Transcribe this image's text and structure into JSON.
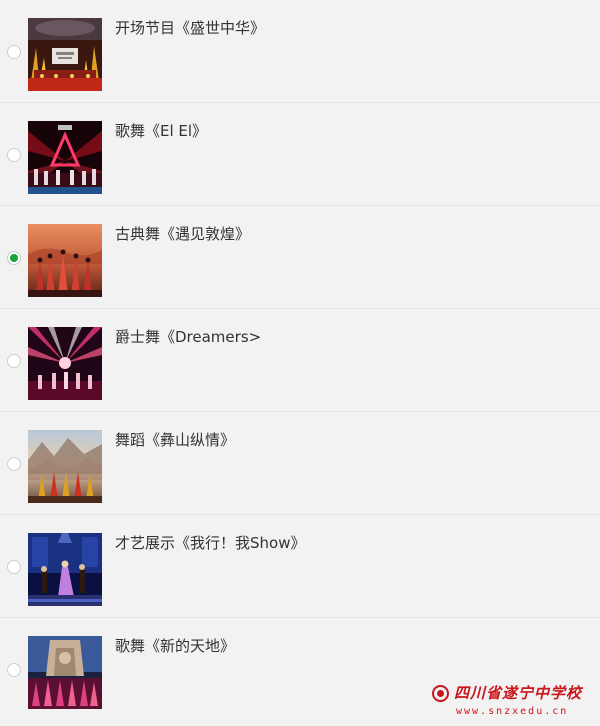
{
  "items": [
    {
      "title": "开场节目《盛世中华》",
      "selected": false,
      "thumbnail": "stage-opening-thumbnail"
    },
    {
      "title": "歌舞《El El》",
      "selected": false,
      "thumbnail": "stage-laser-triangle-thumbnail"
    },
    {
      "title": "古典舞《遇见敦煌》",
      "selected": true,
      "thumbnail": "classical-dance-thumbnail"
    },
    {
      "title": "爵士舞《Dreamers>",
      "selected": false,
      "thumbnail": "jazz-dance-thumbnail"
    },
    {
      "title": "舞蹈《彝山纵情》",
      "selected": false,
      "thumbnail": "folk-dance-thumbnail"
    },
    {
      "title": "才艺展示《我行！我Show》",
      "selected": false,
      "thumbnail": "talent-show-thumbnail"
    },
    {
      "title": "歌舞《新的天地》",
      "selected": false,
      "thumbnail": "song-dance-thumbnail"
    }
  ],
  "watermark": {
    "name": "四川省遂宁中学校",
    "url": "www.snzxedu.cn"
  },
  "colors": {
    "selected_radio": "#13a538",
    "watermark": "#c8161d"
  }
}
